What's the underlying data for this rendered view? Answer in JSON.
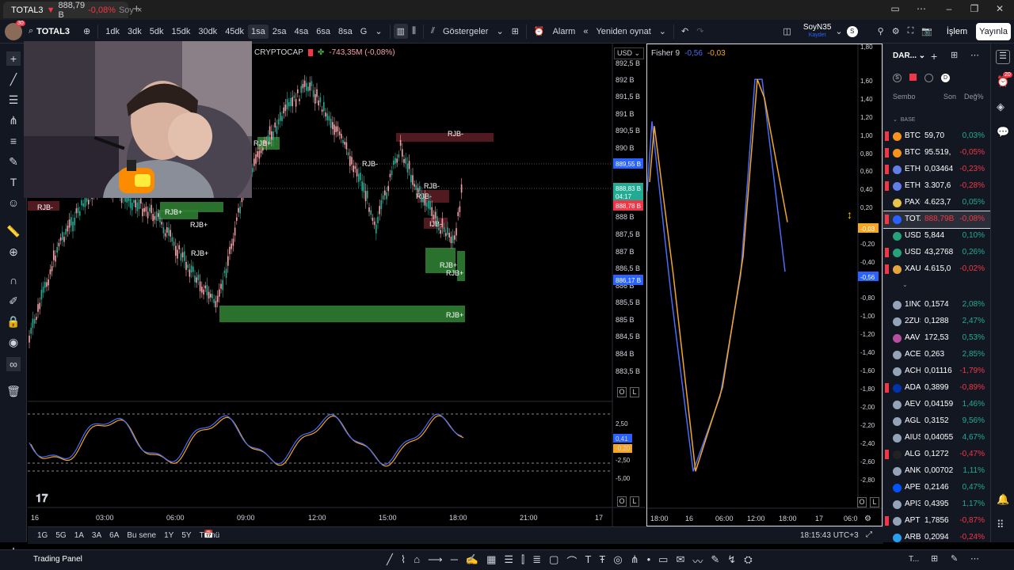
{
  "browser": {
    "tab_title": "TOTAL3",
    "tab_price": "888,79 B",
    "tab_change": "-0,08%",
    "tab_tail": "Soy"
  },
  "toolbar": {
    "symbol": "TOTAL3",
    "intervals": [
      "1dk",
      "3dk",
      "5dk",
      "15dk",
      "30dk",
      "45dk",
      "1sa",
      "2sa",
      "4sa",
      "6sa",
      "8sa",
      "G"
    ],
    "active_interval": "1sa",
    "indicators_label": "Göstergeler",
    "alarm_label": "Alarm",
    "replay_label": "Yeniden oynat",
    "layout_name": "SoyN35",
    "layout_sub": "Kaydet",
    "user_initial": "S",
    "trade_label": "İşlem",
    "publish_label": "Yayınla"
  },
  "main_chart": {
    "legend_source": "CRYPTOCAP",
    "legend_change": "-743,35M (-0,08%)",
    "currency": "USD",
    "price_ticks": [
      "892,5 B",
      "892 B",
      "891,5 B",
      "891 B",
      "890,5 B",
      "890 B",
      "889,55 B",
      "888,83 B",
      "04:17",
      "888,78 B",
      "888 B",
      "887,5 B",
      "887 B",
      "886,5 B",
      "886,17 B",
      "886 B",
      "885,5 B",
      "885 B",
      "884,5 B",
      "884 B",
      "883,5 B"
    ],
    "price_tag_blue_top": "889,55 B",
    "price_tag_last": "888,83 B",
    "price_tag_timer": "04:17",
    "price_tag_red": "888,78 B",
    "price_tag_blue_bottom": "886,17 B",
    "time_ticks": [
      "16",
      "03:00",
      "06:00",
      "09:00",
      "12:00",
      "15:00",
      "18:00",
      "21:00",
      "17"
    ],
    "zone_labels": [
      "RJB-",
      "RJB-",
      "RJB-",
      "RJB-",
      "RJB-",
      "RJB+",
      "RJB+",
      "RJB+",
      "RJB+",
      "RJB+",
      "RJB+",
      "RJB+",
      "IJB-"
    ],
    "osc_ticks": [
      "2,50",
      "0,41",
      "-0,20",
      "-2,50",
      "-5,00"
    ],
    "osc_val_blue": "0,41",
    "osc_val_orange": "-0,20",
    "scale_buttons": [
      "O",
      "L"
    ]
  },
  "fisher": {
    "title": "Fisher 9",
    "val1": "-0,56",
    "val2": "-0,03",
    "ticks": [
      "1,80",
      "1,60",
      "1,40",
      "1,20",
      "1,00",
      "0,80",
      "0,60",
      "0,40",
      "0,20",
      "-0,03",
      "-0,20",
      "-0,40",
      "-0,56",
      "-0,80",
      "-1,00",
      "-1,20",
      "-1,40",
      "-1,60",
      "-1,80",
      "-2,00",
      "-2,20",
      "-2,40",
      "-2,60",
      "-2,80"
    ],
    "time_ticks": [
      "18:00",
      "16",
      "06:00",
      "12:00",
      "18:00",
      "17",
      "06:0"
    ],
    "scale_buttons": [
      "O",
      "L"
    ],
    "tag_orange": "-0,03",
    "tag_blue": "-0,56"
  },
  "watchlist": {
    "title": "DAR...",
    "columns": [
      "Sembo",
      "Son",
      "Değ%"
    ],
    "section": "BASE",
    "rows": [
      {
        "sym": "BTC.",
        "last": "59,70",
        "chg": "0,03%",
        "dir": "up",
        "icon": "#f7931a",
        "flag": true
      },
      {
        "sym": "BTCI",
        "last": "95.519,",
        "chg": "-0,05%",
        "dir": "down",
        "icon": "#f7931a",
        "flag": true
      },
      {
        "sym": "ETHI",
        "last": "0,03464",
        "chg": "-0,23%",
        "dir": "down",
        "icon": "#627eea",
        "flag": true
      },
      {
        "sym": "ETHI",
        "last": "3.307,6",
        "chg": "-0,28%",
        "dir": "down",
        "icon": "#627eea",
        "flag": true
      },
      {
        "sym": "PAXC",
        "last": "4.623,7",
        "chg": "0,05%",
        "dir": "up",
        "icon": "#e6c34a",
        "flag": false
      },
      {
        "sym": "TOTA",
        "last": "888,79B",
        "chg": "-0,08%",
        "dir": "down",
        "icon": "#2962ff",
        "flag": true,
        "selected": true
      },
      {
        "sym": "USDT",
        "last": "5,844",
        "chg": "0,10%",
        "dir": "up",
        "icon": "#26a17b",
        "flag": false
      },
      {
        "sym": "USDT",
        "last": "43,2768",
        "chg": "0,26%",
        "dir": "up",
        "icon": "#26a17b",
        "flag": true
      },
      {
        "sym": "XAUI",
        "last": "4.615,0",
        "chg": "-0,02%",
        "dir": "down",
        "icon": "#e6a53a",
        "flag": true
      },
      {
        "sym": "1INC",
        "last": "0,1574",
        "chg": "2,08%",
        "dir": "up",
        "icon": "#94a3b8",
        "flag": false
      },
      {
        "sym": "2ZUS",
        "last": "0,1288",
        "chg": "2,47%",
        "dir": "up",
        "icon": "#94a3b8",
        "flag": false
      },
      {
        "sym": "AAVE",
        "last": "172,53",
        "chg": "0,53%",
        "dir": "up",
        "icon": "#b6509e",
        "flag": false
      },
      {
        "sym": "ACEI",
        "last": "0,263",
        "chg": "2,85%",
        "dir": "up",
        "icon": "#94a3b8",
        "flag": false
      },
      {
        "sym": "ACHI",
        "last": "0,01116",
        "chg": "-1,79%",
        "dir": "down",
        "icon": "#94a3b8",
        "flag": false
      },
      {
        "sym": "ADAI",
        "last": "0,3899",
        "chg": "-0,89%",
        "dir": "down",
        "icon": "#0033ad",
        "flag": true
      },
      {
        "sym": "AEVC",
        "last": "0,04159",
        "chg": "1,46%",
        "dir": "up",
        "icon": "#94a3b8",
        "flag": false
      },
      {
        "sym": "AGLI",
        "last": "0,3152",
        "chg": "9,56%",
        "dir": "up",
        "icon": "#94a3b8",
        "flag": false
      },
      {
        "sym": "AIUS",
        "last": "0,04055",
        "chg": "4,67%",
        "dir": "up",
        "icon": "#94a3b8",
        "flag": false
      },
      {
        "sym": "ALGO",
        "last": "0,1272",
        "chg": "-0,47%",
        "dir": "down",
        "icon": "#222",
        "flag": true
      },
      {
        "sym": "ANKI",
        "last": "0,00702",
        "chg": "1,11%",
        "dir": "up",
        "icon": "#94a3b8",
        "flag": false
      },
      {
        "sym": "APEI",
        "last": "0,2146",
        "chg": "0,47%",
        "dir": "up",
        "icon": "#0054f9",
        "flag": false
      },
      {
        "sym": "API3",
        "last": "0,4395",
        "chg": "1,17%",
        "dir": "up",
        "icon": "#94a3b8",
        "flag": false
      },
      {
        "sym": "APTI",
        "last": "1,7856",
        "chg": "-0,87%",
        "dir": "down",
        "icon": "#94a3b8",
        "flag": true
      },
      {
        "sym": "ARBI",
        "last": "0,2094",
        "chg": "-0,24%",
        "dir": "down",
        "icon": "#28a0f0",
        "flag": false
      }
    ]
  },
  "bottom": {
    "ranges": [
      "1G",
      "5G",
      "1A",
      "3A",
      "6A",
      "Bu sene",
      "1Y",
      "5Y",
      "Tümü"
    ],
    "clock": "18:15:43 UTC+3",
    "trading_panel": "Trading Panel",
    "tail_label": "T..."
  },
  "notification_count": "20",
  "tab_badge": "30",
  "colors": {
    "up": "#22ab94",
    "down": "#f23645",
    "accent": "#2962ff",
    "fisher_blue": "#4a6cf7",
    "fisher_orange": "#f5a623",
    "candle_up": "#22ab94",
    "candle_down": "#f7a1a8",
    "zone_green": "#2e7d32",
    "zone_red": "#5a1d24"
  },
  "chart_data": [
    {
      "type": "line",
      "title": "Fisher 9",
      "ylim": [
        -2.9,
        1.85
      ],
      "series": [
        {
          "name": "-0,56",
          "values": [
            0.3,
            1.05,
            -0.8,
            -2.7,
            -1.9,
            -0.6,
            1.5,
            1.5,
            -0.56
          ]
        },
        {
          "name": "-0,03",
          "values": [
            0.4,
            1.0,
            -0.6,
            -2.7,
            -1.8,
            -0.4,
            1.5,
            1.3,
            -0.03
          ]
        }
      ]
    }
  ]
}
